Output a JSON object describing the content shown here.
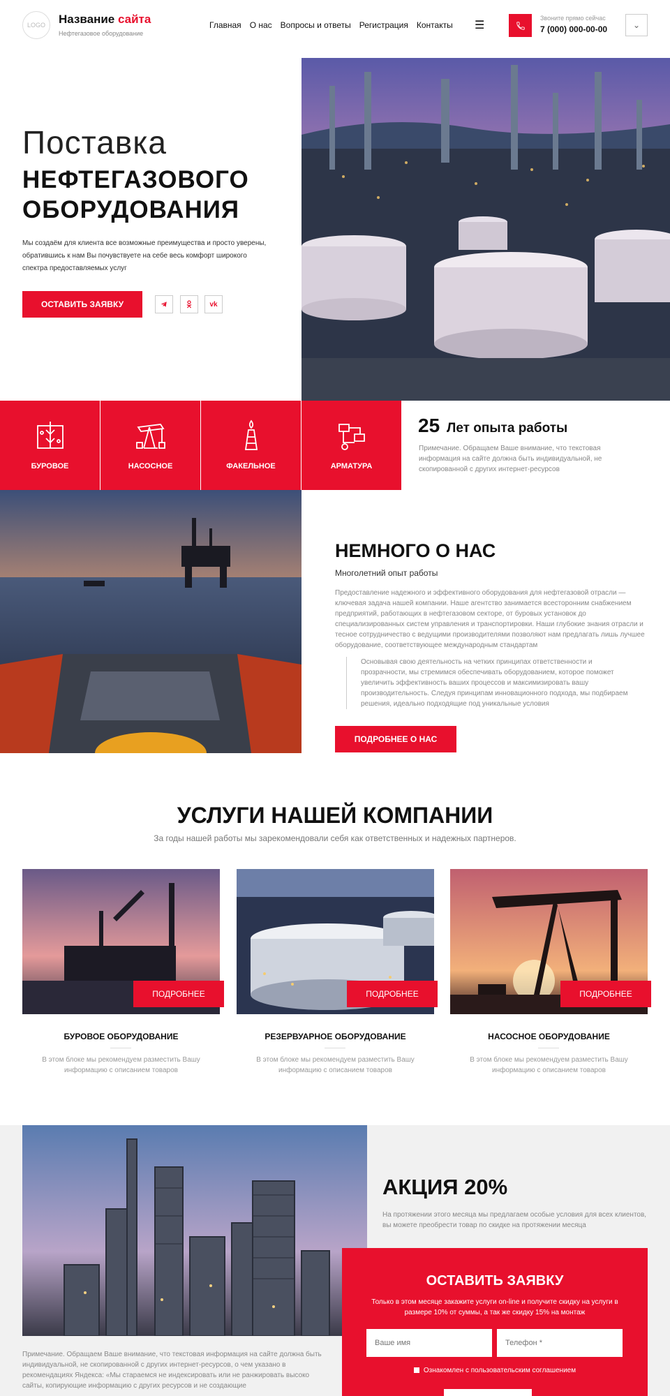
{
  "header": {
    "logo_text": "LOGO",
    "site_name_part1": "Название",
    "site_name_part2": "сайта",
    "site_subtitle": "Нефтегазовое оборудование",
    "nav": [
      "Главная",
      "О нас",
      "Вопросы и ответы",
      "Регистрация",
      "Контакты"
    ],
    "call_label": "Звоните прямо сейчас",
    "phone": "7 (000) 000-00-00"
  },
  "hero": {
    "line1": "Поставка",
    "line2": "НЕФТЕГАЗОВОГО",
    "line3": "ОБОРУДОВАНИЯ",
    "description": "Мы создаём для клиента все возможные преимущества и просто уверены, обратившись к нам Вы почувствуете на себе весь комфорт широкого спектра предоставляемых услуг",
    "cta": "ОСТАВИТЬ ЗАЯВКУ"
  },
  "categories": [
    "БУРОВОЕ",
    "НАСОСНОЕ",
    "ФАКЕЛЬНОЕ",
    "АРМАТУРА"
  ],
  "experience": {
    "number": "25",
    "label": "Лет опыта работы",
    "note": "Примечание. Обращаем Ваше внимание, что текстовая информация на сайте должна быть индивидуальной, не скопированной с других интернет-ресурсов"
  },
  "about": {
    "title": "НЕМНОГО О НАС",
    "subtitle": "Многолетний опыт работы",
    "paragraph": "Предоставление надежного и эффективного оборудования для нефтегазовой отрасли — ключевая задача нашей компании. Наше агентство занимается всесторонним снабжением предприятий, работающих в нефтегазовом секторе, от буровых установок до специализированных систем управления и транспортировки. Наши глубокие знания отрасли и тесное сотрудничество с ведущими производителями позволяют нам предлагать лишь лучшее оборудование, соответствующее международным стандартам",
    "quote": "Основывая свою деятельность на четких принципах ответственности и прозрачности, мы стремимся обеспечивать оборудованием, которое поможет увеличить эффективность ваших процессов и максимизировать вашу производительность. Следуя принципам инновационного подхода, мы подбираем решения, идеально подходящие под уникальные условия",
    "button": "ПОДРОБНЕЕ О НАС"
  },
  "services": {
    "title": "УСЛУГИ НАШЕЙ КОМПАНИИ",
    "subtitle": "За годы нашей работы мы зарекомендовали себя как ответственных и надежных партнеров.",
    "cards": [
      {
        "button": "ПОДРОБНЕЕ",
        "title": "БУРОВОЕ ОБОРУДОВАНИЕ",
        "desc": "В этом блоке мы рекомендуем разместить Вашу информацию с описанием товаров"
      },
      {
        "button": "ПОДРОБНЕЕ",
        "title": "РЕЗЕРВУАРНОЕ ОБОРУДОВАНИЕ",
        "desc": "В этом блоке мы рекомендуем разместить Вашу информацию с описанием товаров"
      },
      {
        "button": "ПОДРОБНЕЕ",
        "title": "НАСОСНОЕ ОБОРУДОВАНИЕ",
        "desc": "В этом блоке мы рекомендуем разместить Вашу информацию с описанием товаров"
      }
    ]
  },
  "promo": {
    "title": "АКЦИЯ 20%",
    "description": "На протяжении этого месяца мы предлагаем особые условия для всех клиентов, вы можете преобрести товар по скидке на протяжении месяца",
    "note": "Примечание. Обращаем Ваше внимание, что текстовая информация на сайте должна быть индивидуальной, не скопированной с других интернет-ресурсов, о чем указано в рекомендациях Яндекса: «Мы стараемся не индексировать или не ранжировать высоко сайты, копирующие информацию с других ресурсов и не создающие",
    "form": {
      "title": "ОСТАВИТЬ ЗАЯВКУ",
      "description": "Только в этом месяце закажите услуги on-line и получите скидку на услуги в размере 10% от суммы, а так же скидку 15% на монтаж",
      "name_placeholder": "Ваше имя",
      "phone_placeholder": "Телефон *",
      "agreement": "Ознакомлен с пользовательским соглашением"
    }
  },
  "colors": {
    "accent": "#e8102d"
  }
}
